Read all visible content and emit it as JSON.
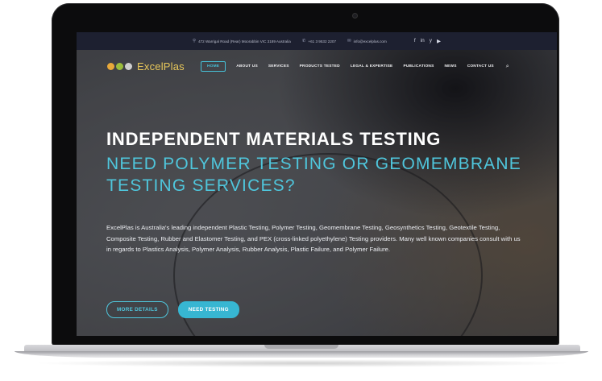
{
  "topbar": {
    "address": "472 Warrigal Road (Rear) Moorabbin VIC 3189 Australia",
    "phone": "+61 3 9532 2207",
    "email": "info@excelplas.com",
    "social": [
      "f",
      "in",
      "y",
      "▶"
    ]
  },
  "brand": {
    "name": "ExcelPlas",
    "dot_colors": [
      "#e8a93a",
      "#9bbd3c",
      "#cfcfcf"
    ]
  },
  "nav": {
    "items": [
      {
        "label": "HOME",
        "active": true
      },
      {
        "label": "ABOUT US"
      },
      {
        "label": "SERVICES"
      },
      {
        "label": "PRODUCTS TESTED"
      },
      {
        "label": "LEGAL & EXPERTISE"
      },
      {
        "label": "PUBLICATIONS"
      },
      {
        "label": "NEWS"
      },
      {
        "label": "CONTACT US"
      }
    ]
  },
  "hero": {
    "headline": "INDEPENDENT MATERIALS TESTING",
    "subheadline": "NEED POLYMER TESTING OR GEOMEMBRANE TESTING SERVICES?",
    "description": "ExcelPlas is Australia's leading independent Plastic Testing, Polymer Testing, Geomembrane Testing, Geosynthetics Testing, Geotextile Testing, Composite Testing, Rubber and Elastomer Testing, and PEX (cross-linked polyethylene) Testing providers. Many well known companies consult with us in regards to Plastics Analysis, Polymer Analysis, Rubber Analysis, Plastic Failure, and Polymer Failure.",
    "primary_button": "NEED TESTING",
    "secondary_button": "MORE DETAILS"
  },
  "colors": {
    "accent": "#47c1d8",
    "topbar_bg": "#1d2030",
    "brand_text": "#e8c75a"
  }
}
